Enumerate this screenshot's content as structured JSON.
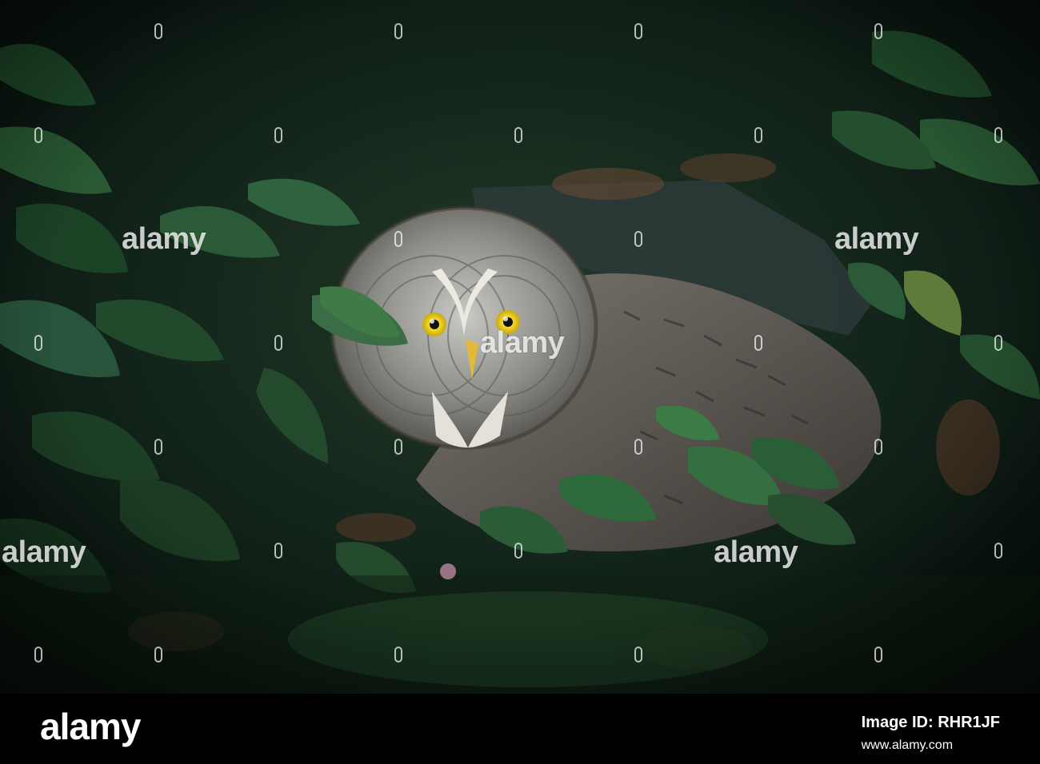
{
  "photo": {
    "subject": "great-grey-owl-in-undergrowth",
    "colors": {
      "foliage_dark": "#0b1a10",
      "foliage_mid": "#1f4a2a",
      "foliage_light": "#3f7a47",
      "owl_grey": "#8a8a86",
      "owl_dark": "#4a4640",
      "eye_yellow": "#f1d21c",
      "beak_yellow": "#e6c13a"
    }
  },
  "watermark": {
    "text": "alamy"
  },
  "footer": {
    "logo": "alamy",
    "image_id_label": "Image ID: RHR1JF",
    "site": "www.alamy.com"
  }
}
